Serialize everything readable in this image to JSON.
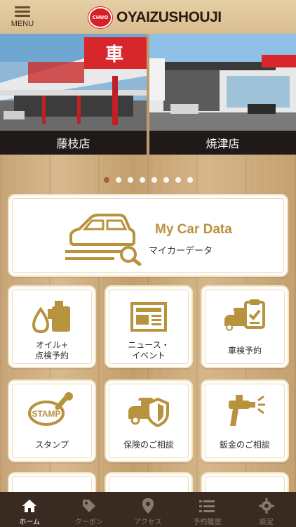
{
  "header": {
    "menu_label": "MENU",
    "logo_badge": "CHUO",
    "logo_text": "OYAIZUSHOUJI"
  },
  "slider": {
    "slides": [
      {
        "caption": "藤枝店"
      },
      {
        "caption": "焼津店"
      }
    ],
    "dot_count": 8,
    "active_dot": 0
  },
  "my_car": {
    "title": "My Car Data",
    "subtitle": "マイカーデータ"
  },
  "tiles": [
    {
      "label": "オイル+\n点検予約"
    },
    {
      "label": "ニュース・\nイベント"
    },
    {
      "label": "車検予約"
    },
    {
      "label": "スタンプ"
    },
    {
      "label": "保険のご相談"
    },
    {
      "label": "鈑金のご相談"
    }
  ],
  "stamp_text": "STAMP",
  "bottom_nav": [
    {
      "label": "ホーム",
      "icon": "home-icon",
      "active": true
    },
    {
      "label": "クーポン",
      "icon": "tag-icon"
    },
    {
      "label": "アクセス",
      "icon": "location-pin-icon"
    },
    {
      "label": "予約履歴",
      "icon": "list-icon"
    },
    {
      "label": "設定",
      "icon": "gear-icon"
    }
  ],
  "colors": {
    "accent_gold": "#b8933e",
    "brand_red": "#d71f26",
    "nav_bg": "#3a2b22"
  }
}
